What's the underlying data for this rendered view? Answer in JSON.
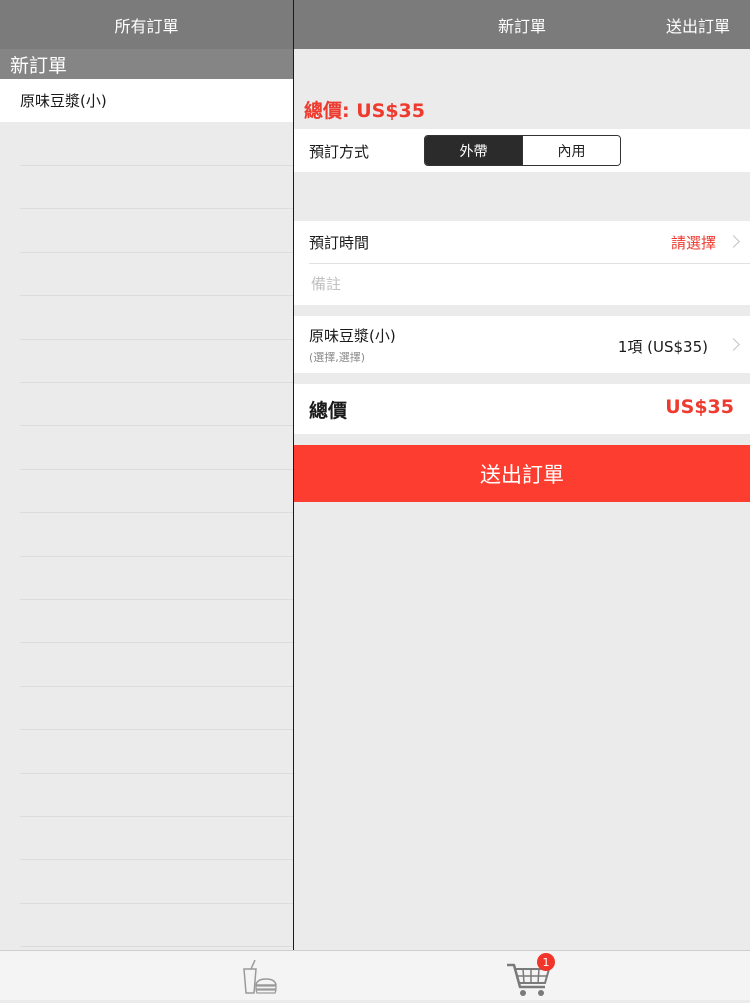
{
  "left": {
    "header_title": "所有訂單",
    "section_title": "新訂單",
    "items": [
      {
        "label": "原味豆漿(小)"
      }
    ]
  },
  "right": {
    "header_title": "新訂單",
    "header_action": "送出訂單",
    "total_summary": "總價: US$35",
    "order_type": {
      "label": "預訂方式",
      "options": [
        "外帶",
        "內用"
      ],
      "selected": "外帶"
    },
    "time": {
      "label": "預訂時間",
      "value": "請選擇"
    },
    "note": {
      "placeholder": "備註",
      "value": ""
    },
    "item": {
      "name": "原味豆漿(小)",
      "options": "(選擇,選擇)",
      "quantity": "1項 (US$35)"
    },
    "total": {
      "label": "總價",
      "value": "US$35"
    },
    "submit_label": "送出訂單"
  },
  "tabbar": {
    "tabs": [
      {
        "icon": "drink-burger-icon"
      },
      {
        "icon": "shopping-cart-icon"
      }
    ],
    "cart_badge": "1"
  },
  "colors": {
    "accent_red": "#fc3d2f",
    "header_gray": "#7b7b7b"
  }
}
